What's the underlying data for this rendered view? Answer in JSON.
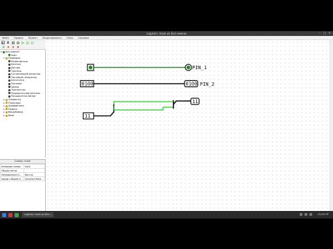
{
  "window": {
    "title": "Logisim: main из Без имени"
  },
  "menu": [
    "Файл",
    "Правка",
    "Проект",
    "Моделировать",
    "Окно",
    "Справка"
  ],
  "toolbar": [
    "pointer-tool",
    "text-tool",
    "input-tool",
    "output-tool",
    "not-gate",
    "and-gate",
    "or-gate"
  ],
  "tree": [
    {
      "label": "Без имени*",
      "indent": 0,
      "expander": "▾",
      "icon": "#2c7a2c"
    },
    {
      "label": "main",
      "indent": 2,
      "expander": "",
      "icon": "#2c7a2c"
    },
    {
      "label": "Проводка",
      "indent": 1,
      "expander": "▾",
      "icon": "#c8a040"
    },
    {
      "label": "Разветвитель",
      "indent": 2,
      "expander": "",
      "icon": "#444"
    },
    {
      "label": "Контакт",
      "indent": 2,
      "expander": "",
      "icon": "#444"
    },
    {
      "label": "Датчик",
      "indent": 2,
      "expander": "",
      "icon": "#444"
    },
    {
      "label": "Тоннель",
      "indent": 2,
      "expander": "",
      "icon": "#444"
    },
    {
      "label": "Согласующий резистор",
      "indent": 2,
      "expander": "",
      "icon": "#444"
    },
    {
      "label": "Тактовый генератор",
      "indent": 2,
      "expander": "",
      "icon": "#444"
    },
    {
      "label": "Константа",
      "indent": 2,
      "expander": "",
      "icon": "#444"
    },
    {
      "label": "Питание",
      "indent": 2,
      "expander": "",
      "icon": "#444"
    },
    {
      "label": "Земля",
      "indent": 2,
      "expander": "",
      "icon": "#444"
    },
    {
      "label": "Транзистор",
      "indent": 2,
      "expander": "",
      "icon": "#444"
    },
    {
      "label": "Передаточный вентиль",
      "indent": 2,
      "expander": "",
      "icon": "#444"
    },
    {
      "label": "Расширитель битов",
      "indent": 2,
      "expander": "",
      "icon": "#444"
    },
    {
      "label": "Элементы",
      "indent": 1,
      "expander": "▸",
      "icon": "#c8a040"
    },
    {
      "label": "Плексоры",
      "indent": 1,
      "expander": "▸",
      "icon": "#c8a040"
    },
    {
      "label": "Арифметика",
      "indent": 1,
      "expander": "▸",
      "icon": "#c8a040"
    },
    {
      "label": "Память",
      "indent": 1,
      "expander": "▸",
      "icon": "#c8a040"
    },
    {
      "label": "Ввод/вывод",
      "indent": 1,
      "expander": "▸",
      "icon": "#c8a040"
    },
    {
      "label": "Base",
      "indent": 1,
      "expander": "▸",
      "icon": "#c8a040"
    }
  ],
  "props": {
    "title": "Схема: main",
    "rows": [
      {
        "k": "Название схемы",
        "v": "main"
      },
      {
        "k": "Общая метка",
        "v": ""
      },
      {
        "k": "Направление м...",
        "v": "Восток"
      },
      {
        "k": "Шрифт общей м...",
        "v": "SansSerif Bold..."
      }
    ]
  },
  "canvas": {
    "pin1_label": "PIN_1",
    "pin2_label": "PIN_2",
    "pin2_input_value": "0100",
    "pin2_output_value": "0100",
    "splitter_input_value": "11",
    "splitter_output_value": "11",
    "wire_on_color": "#22cc22",
    "wire_bus_color": "#000000"
  },
  "taskbar": {
    "task_label": "Logisim: main из Без...",
    "clock": "15:05 ПТ"
  }
}
